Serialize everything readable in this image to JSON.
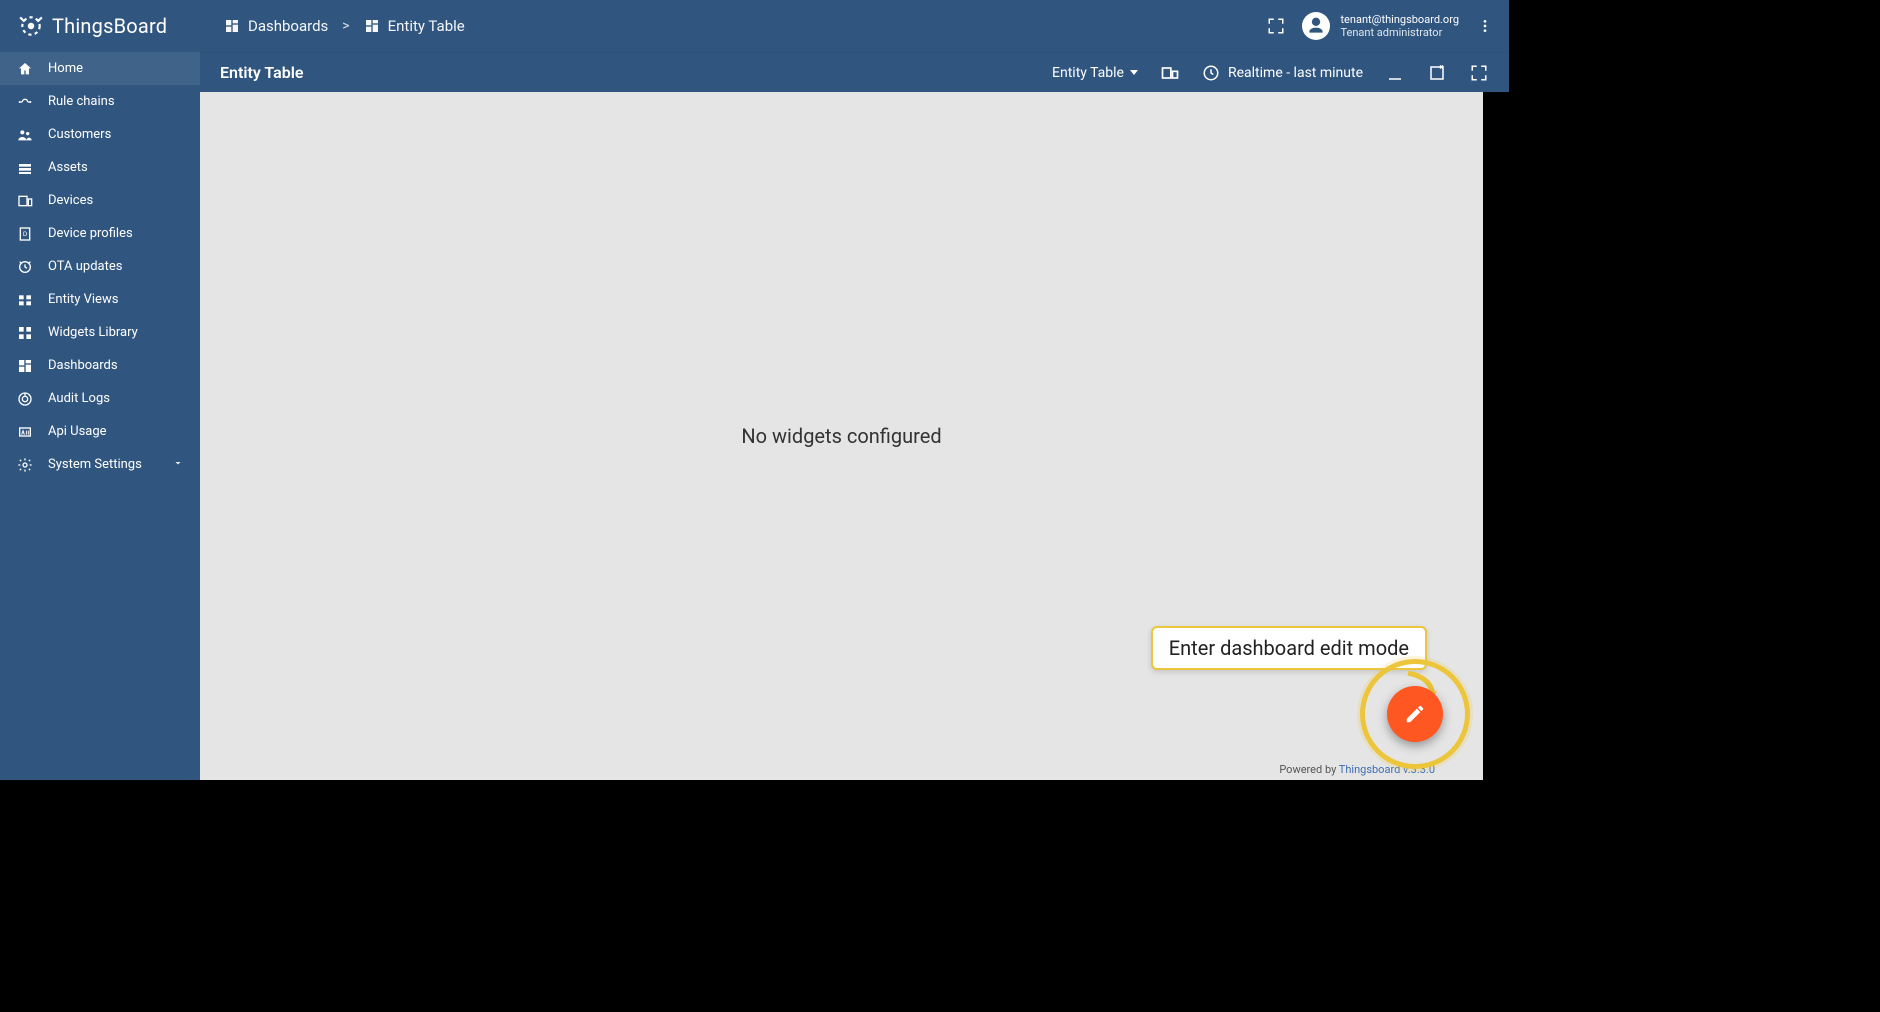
{
  "brand": {
    "name": "ThingsBoard"
  },
  "breadcrumbs": {
    "root": "Dashboards",
    "current": "Entity Table"
  },
  "user": {
    "email": "tenant@thingsboard.org",
    "role": "Tenant administrator"
  },
  "sidebar": {
    "items": [
      {
        "id": "home",
        "label": "Home",
        "icon": "home"
      },
      {
        "id": "rule-chains",
        "label": "Rule chains",
        "icon": "rulechain"
      },
      {
        "id": "customers",
        "label": "Customers",
        "icon": "customers"
      },
      {
        "id": "assets",
        "label": "Assets",
        "icon": "assets"
      },
      {
        "id": "devices",
        "label": "Devices",
        "icon": "devices"
      },
      {
        "id": "device-profiles",
        "label": "Device profiles",
        "icon": "deviceprofile"
      },
      {
        "id": "ota-updates",
        "label": "OTA updates",
        "icon": "ota"
      },
      {
        "id": "entity-views",
        "label": "Entity Views",
        "icon": "entityviews"
      },
      {
        "id": "widgets-library",
        "label": "Widgets Library",
        "icon": "widgets"
      },
      {
        "id": "dashboards",
        "label": "Dashboards",
        "icon": "dashboards"
      },
      {
        "id": "audit-logs",
        "label": "Audit Logs",
        "icon": "audit"
      },
      {
        "id": "api-usage",
        "label": "Api Usage",
        "icon": "api"
      },
      {
        "id": "system-settings",
        "label": "System Settings",
        "icon": "settings",
        "expandable": true
      }
    ],
    "active": "home"
  },
  "dashboard": {
    "title": "Entity Table",
    "state_selector": "Entity Table",
    "timewindow": "Realtime - last minute",
    "empty_message": "No widgets configured"
  },
  "annotation": {
    "tooltip": "Enter dashboard edit mode"
  },
  "footer": {
    "prefix": "Powered by ",
    "link_text": "Thingsboard v.3.3.0"
  }
}
